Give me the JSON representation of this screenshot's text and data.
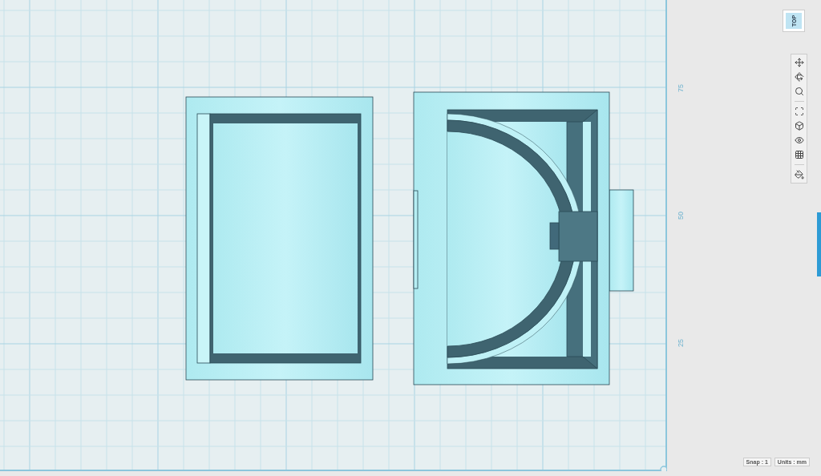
{
  "view_cube": {
    "label": "TOP",
    "selected": true
  },
  "ruler": {
    "labels": [
      "75",
      "50",
      "25"
    ]
  },
  "status_bar": {
    "snap": "Snap : 1",
    "units": "Units : mm"
  }
}
